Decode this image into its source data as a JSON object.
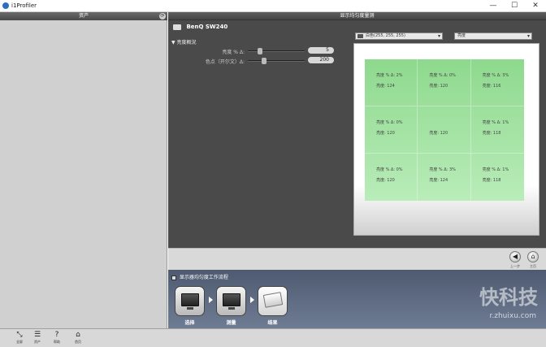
{
  "window": {
    "title": "i1Profiler",
    "min": "—",
    "max": "☐",
    "close": "✕"
  },
  "left_panel": {
    "header": "资产",
    "header_btn": "⟳"
  },
  "main": {
    "header": "显示均匀度量测",
    "device": "BenQ SW240",
    "section": "▼ 亮度概況",
    "settings": [
      {
        "label": "亮度 % Δ:",
        "value": "5"
      },
      {
        "label": "色点（开尔文）Δ:",
        "value": "200"
      }
    ]
  },
  "preview": {
    "display_combo": "白色(255, 255, 255)",
    "mode_combo": "亮度",
    "cells": [
      {
        "l1": "亮度 % Δ:   2%",
        "l2": "亮度:  124"
      },
      {
        "l1": "亮度 % Δ:   0%",
        "l2": "亮度:  120"
      },
      {
        "l1": "亮度 % Δ:   3%",
        "l2": "亮度:  116"
      },
      {
        "l1": "亮度 % Δ:   0%",
        "l2": "亮度:  120"
      },
      {
        "l1": "",
        "l2": "亮度:  120"
      },
      {
        "l1": "亮度 % Δ:   1%",
        "l2": "亮度:  118"
      },
      {
        "l1": "亮度 % Δ:   0%",
        "l2": "亮度:  120"
      },
      {
        "l1": "亮度 % Δ:   3%",
        "l2": "亮度:  124"
      },
      {
        "l1": "亮度 % Δ:   1%",
        "l2": "亮度:  118"
      }
    ]
  },
  "nav": {
    "prev_label": "上一步",
    "home_label": "主页",
    "prev_icon": "◀",
    "home_icon": "⌂"
  },
  "workflow": {
    "title": "显示器均匀度工作流程",
    "steps": [
      {
        "label": "选择"
      },
      {
        "label": "测量"
      },
      {
        "label": "结果"
      }
    ],
    "watermark": "快科技",
    "watermark_url": "r.zhuixu.com"
  },
  "bottombar": {
    "tools": [
      {
        "icon": "⤡",
        "label": "全屏"
      },
      {
        "icon": "☰",
        "label": "资产"
      },
      {
        "icon": "?",
        "label": "帮助"
      },
      {
        "icon": "⌂",
        "label": "首页"
      }
    ]
  }
}
